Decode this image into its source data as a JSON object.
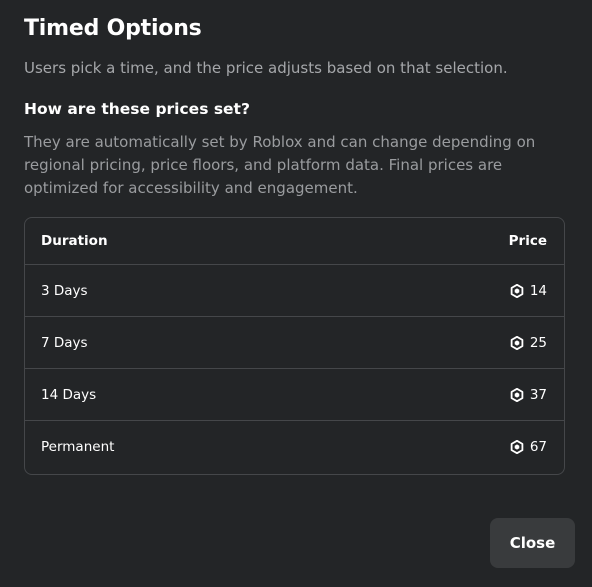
{
  "dialog": {
    "title": "Timed Options",
    "subtitle": "Users pick a time, and the price adjusts based on that selection."
  },
  "faq": {
    "heading": "How are these prices set?",
    "body": "They are automatically set by Roblox and can change depending on regional pricing, price floors, and platform data. Final prices are optimized for accessibility and engagement."
  },
  "table": {
    "headers": {
      "duration": "Duration",
      "price": "Price"
    },
    "rows": [
      {
        "duration": "3 Days",
        "price": "14",
        "icon": "robux-icon"
      },
      {
        "duration": "7 Days",
        "price": "25",
        "icon": "robux-icon"
      },
      {
        "duration": "14 Days",
        "price": "37",
        "icon": "robux-icon"
      },
      {
        "duration": "Permanent",
        "price": "67",
        "icon": "robux-icon"
      }
    ]
  },
  "actions": {
    "close_label": "Close"
  },
  "colors": {
    "background": "#232527",
    "border": "#45474a",
    "muted_text": "#a5a7aa",
    "button_bg": "#393b3d"
  }
}
